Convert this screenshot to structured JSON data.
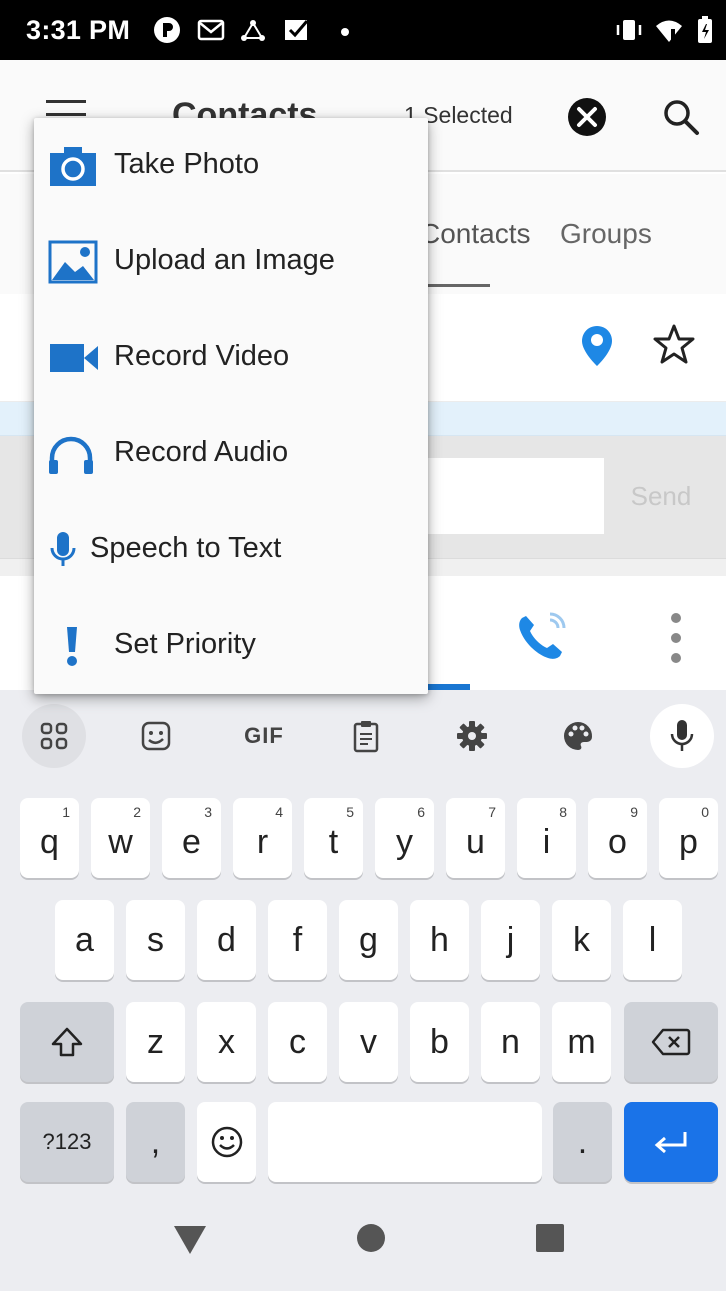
{
  "status_bar": {
    "time": "3:31 PM",
    "icons": [
      "notification-p-icon",
      "gmail-icon",
      "network-icon",
      "checkbox-notification-icon",
      "dot-icon",
      "vibrate-icon",
      "wifi-icon",
      "battery-icon"
    ]
  },
  "app_bar": {
    "title": "Contacts",
    "selected": "1 Selected",
    "icons": [
      "menu-icon",
      "close-icon",
      "search-icon"
    ]
  },
  "tabs": [
    {
      "label": "Contacts"
    },
    {
      "label": "Groups"
    }
  ],
  "composer": {
    "send_label": "Send"
  },
  "popup_menu": {
    "items": [
      {
        "label": "Take Photo",
        "icon": "camera-icon"
      },
      {
        "label": "Upload an Image",
        "icon": "image-icon"
      },
      {
        "label": "Record Video",
        "icon": "video-camera-icon"
      },
      {
        "label": "Record Audio",
        "icon": "headphones-icon"
      },
      {
        "label": "Speech to Text",
        "icon": "microphone-icon"
      },
      {
        "label": "Set Priority",
        "icon": "exclamation-icon"
      }
    ],
    "accent_color": "#1e73c8"
  },
  "keyboard": {
    "toolbar": [
      "apps-icon",
      "sticker-icon",
      "GIF",
      "clipboard-icon",
      "settings-icon",
      "palette-icon",
      "microphone-icon"
    ],
    "row1": [
      {
        "key": "q",
        "hint": "1"
      },
      {
        "key": "w",
        "hint": "2"
      },
      {
        "key": "e",
        "hint": "3"
      },
      {
        "key": "r",
        "hint": "4"
      },
      {
        "key": "t",
        "hint": "5"
      },
      {
        "key": "y",
        "hint": "6"
      },
      {
        "key": "u",
        "hint": "7"
      },
      {
        "key": "i",
        "hint": "8"
      },
      {
        "key": "o",
        "hint": "9"
      },
      {
        "key": "p",
        "hint": "0"
      }
    ],
    "row2": [
      "a",
      "s",
      "d",
      "f",
      "g",
      "h",
      "j",
      "k",
      "l"
    ],
    "row3": [
      "z",
      "x",
      "c",
      "v",
      "b",
      "n",
      "m"
    ],
    "row4": {
      "symbols": "?123",
      "comma": ",",
      "period": "."
    },
    "enter_color": "#1a73e8"
  }
}
